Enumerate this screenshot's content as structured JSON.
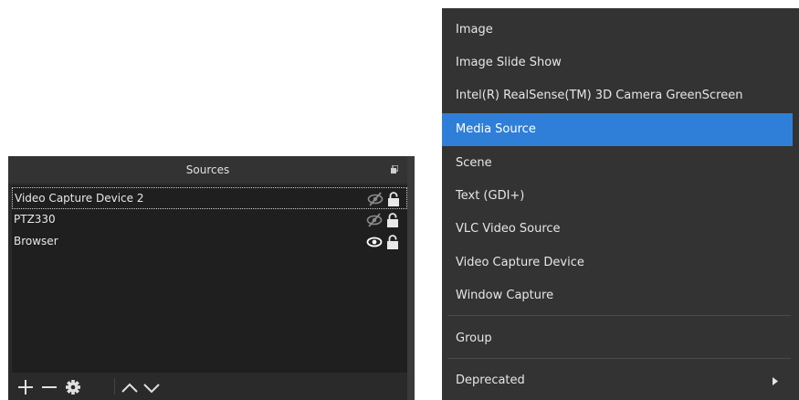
{
  "sources_dock": {
    "title": "Sources",
    "float_icon": "dock-float-icon",
    "items": [
      {
        "name": "Video Capture Device 2",
        "visible": false,
        "locked": true,
        "selected": true
      },
      {
        "name": "PTZ330",
        "visible": false,
        "locked": true,
        "selected": false
      },
      {
        "name": "Browser",
        "visible": true,
        "locked": true,
        "selected": false
      }
    ],
    "toolbar": {
      "add": "plus-icon",
      "remove": "minus-icon",
      "properties": "gear-icon",
      "move_up": "chevron-up-icon",
      "move_down": "chevron-down-icon"
    }
  },
  "context_menu": {
    "items": [
      {
        "label": "Image"
      },
      {
        "label": "Image Slide Show"
      },
      {
        "label": "Intel(R) RealSense(TM) 3D Camera GreenScreen"
      },
      {
        "label": "Media Source",
        "highlighted": true
      },
      {
        "label": "Scene"
      },
      {
        "label": "Text (GDI+)"
      },
      {
        "label": "VLC Video Source"
      },
      {
        "label": "Video Capture Device"
      },
      {
        "label": "Window Capture"
      }
    ],
    "group_label": "Group",
    "deprecated_label": "Deprecated",
    "submenu_icon": "chevron-right-icon"
  },
  "colors": {
    "highlight": "#2f7fd8",
    "menu_bg": "#333333",
    "list_bg": "#1f1f1f",
    "text": "#e8e8e8"
  }
}
